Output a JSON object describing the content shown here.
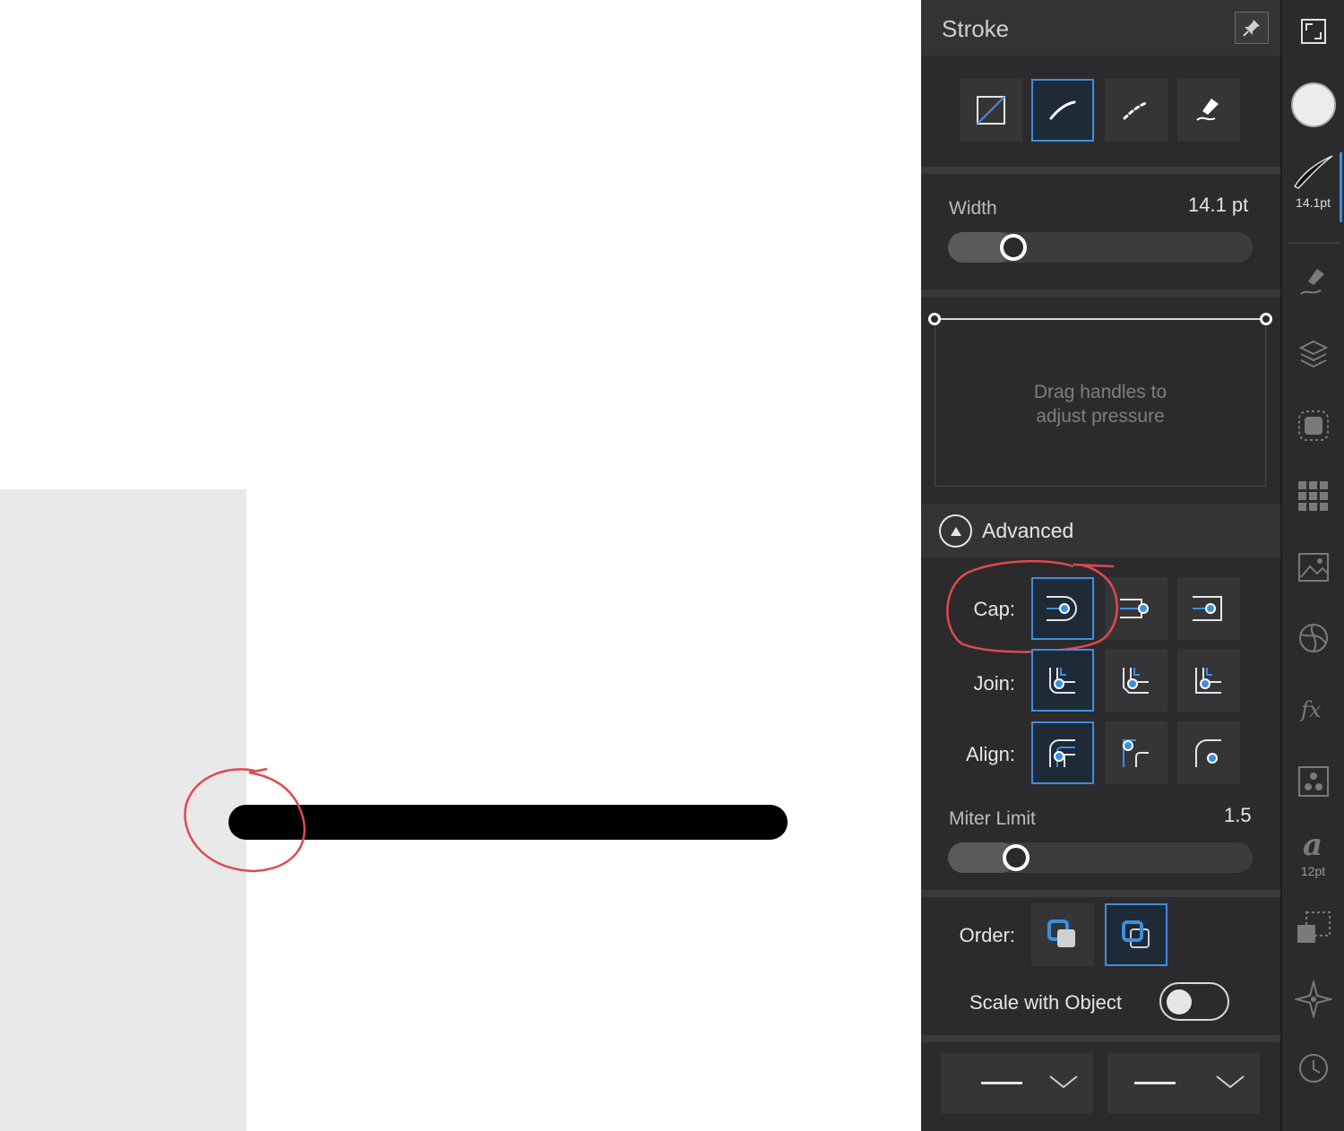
{
  "panel": {
    "title": "Stroke",
    "width": {
      "label": "Width",
      "value": "14.1 pt",
      "fraction": 0.1
    },
    "pressure_hint": "Drag handles to\nadjust pressure",
    "advanced": {
      "label": "Advanced"
    },
    "cap": {
      "label": "Cap:",
      "selected": 0
    },
    "join": {
      "label": "Join:",
      "selected": 0
    },
    "align": {
      "label": "Align:",
      "selected": 0
    },
    "miter": {
      "label": "Miter Limit",
      "value": "1.5",
      "fraction": 0.1
    },
    "order": {
      "label": "Order:",
      "selected": 1
    },
    "scale_with_object": {
      "label": "Scale with Object",
      "on": false
    }
  },
  "toolbar": {
    "brush_caption": "14.1pt",
    "text_caption": "12pt"
  },
  "colors": {
    "accent": "#3d8ee0",
    "annotation": "#e0494f",
    "panel_bg": "#2b2b2d"
  }
}
